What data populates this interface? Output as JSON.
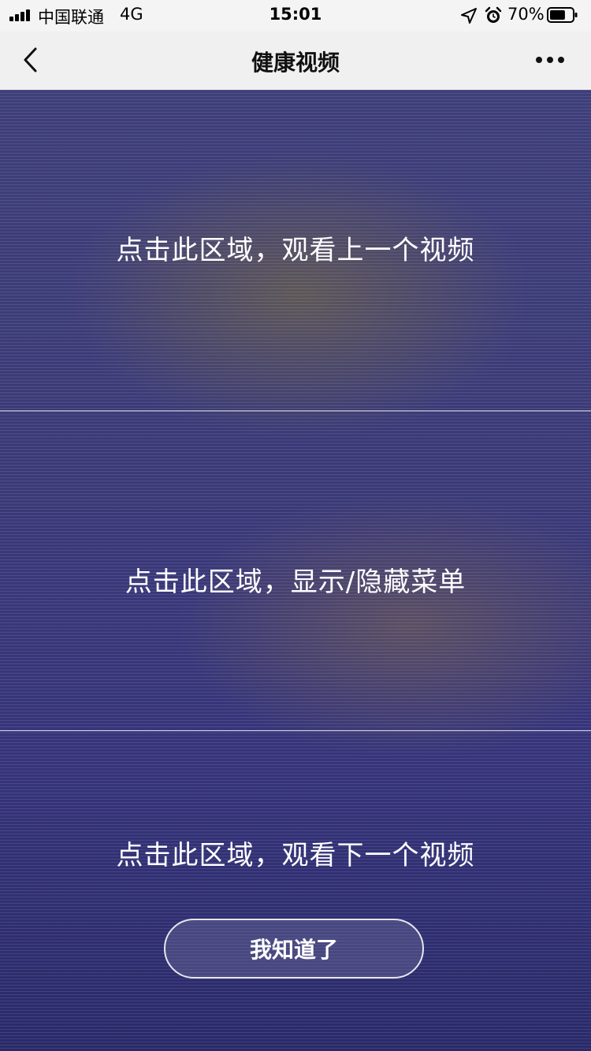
{
  "status_bar": {
    "carrier": "中国联通",
    "network": "4G",
    "time": "15:01",
    "battery_percent": "70%",
    "battery_level": 0.7,
    "signal_bars": 4,
    "icons": [
      "signal-icon",
      "location-arrow-icon",
      "alarm-clock-icon",
      "battery-icon"
    ]
  },
  "nav": {
    "title": "健康视频",
    "back_icon": "chevron-left-icon",
    "more_icon": "more-dots-icon"
  },
  "overlay": {
    "prev_zone_text": "点击此区域，观看上一个视频",
    "menu_zone_text": "点击此区域，显示/隐藏菜单",
    "next_zone_text": "点击此区域，观看下一个视频",
    "got_it_button": "我知道了"
  },
  "colors": {
    "overlay_top": "#3e3e7a",
    "overlay_bottom": "#2a2a6a",
    "text": "#ffffff",
    "nav_background": "#f0f0f0"
  }
}
